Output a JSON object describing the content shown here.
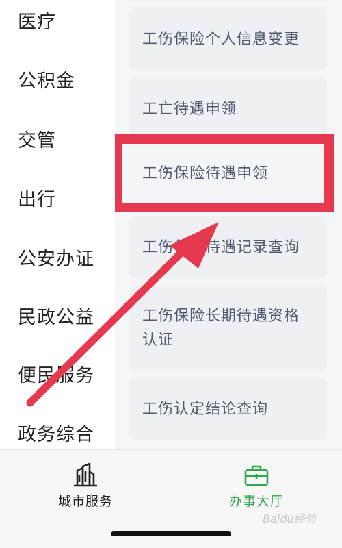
{
  "sidebar": {
    "items": [
      {
        "label": "医疗"
      },
      {
        "label": "公积金"
      },
      {
        "label": "交管"
      },
      {
        "label": "出行"
      },
      {
        "label": "公安办证"
      },
      {
        "label": "民政公益"
      },
      {
        "label": "便民服务"
      },
      {
        "label": "政务综合"
      }
    ]
  },
  "services": [
    {
      "label": "工伤保险个人信息变更"
    },
    {
      "label": "工亡待遇申领"
    },
    {
      "label": "工伤保险待遇申领",
      "highlighted": true
    },
    {
      "label": "工伤保险待遇记录查询"
    },
    {
      "label": "工伤保险长期待遇资格认证"
    },
    {
      "label": "工伤认定结论查询"
    }
  ],
  "tabbar": {
    "tabs": [
      {
        "label": "城市服务",
        "icon": "buildings-icon",
        "color": "#222222"
      },
      {
        "label": "办事大厅",
        "icon": "briefcase-icon",
        "color": "#2fa84f",
        "active": true
      }
    ]
  },
  "annotation": {
    "color": "#e53950"
  },
  "watermark": {
    "text": "Baidu经验"
  }
}
